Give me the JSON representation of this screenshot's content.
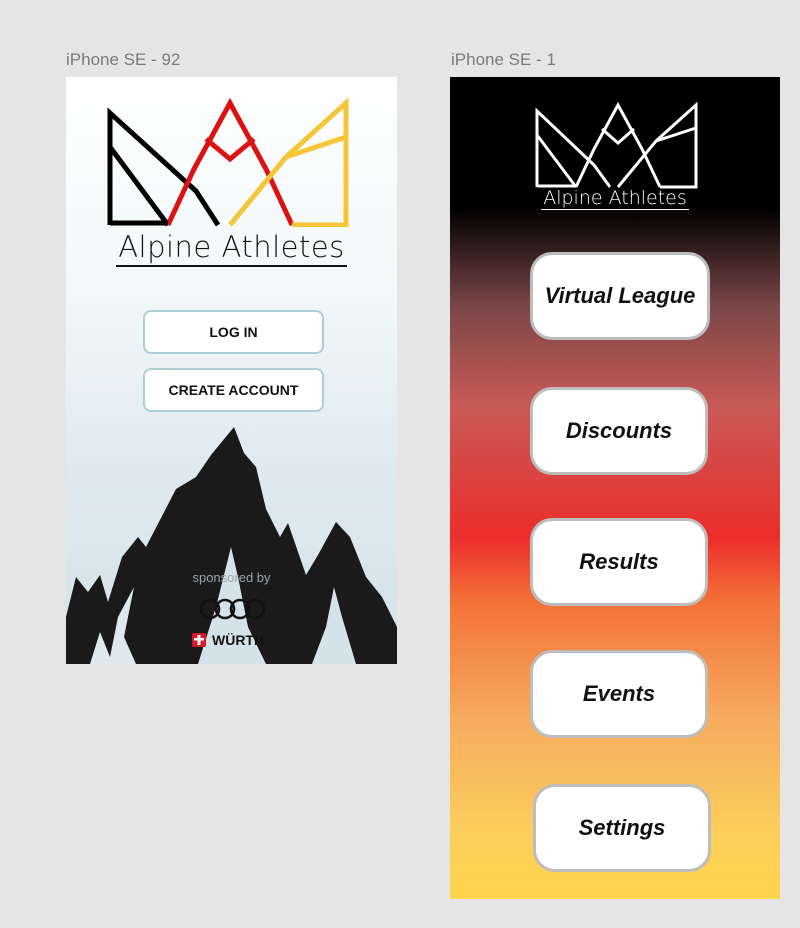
{
  "frames": [
    {
      "label": "iPhone SE - 92",
      "brand": "Alpine Athletes",
      "buttons": {
        "login": "LOG IN",
        "create_account": "CREATE ACCOUNT"
      },
      "sponsored_label": "sponsored by",
      "sponsors": {
        "audi_logo": "audi-rings-logo",
        "wurth": "WÜRTH"
      }
    },
    {
      "label": "iPhone SE - 1",
      "brand": "Alpine Athletes",
      "menu": [
        {
          "label": "Virtual League"
        },
        {
          "label": "Discounts"
        },
        {
          "label": "Results"
        },
        {
          "label": "Events"
        },
        {
          "label": "Settings"
        }
      ]
    }
  ],
  "colors": {
    "canvas": "#e5e5e5",
    "logo_black": "#000000",
    "logo_red": "#dd1111",
    "logo_yellow": "#f5c638",
    "button_border": "#a9cfd3",
    "menu_border": "#bdbdbd",
    "wurth_red": "#d7182a"
  }
}
